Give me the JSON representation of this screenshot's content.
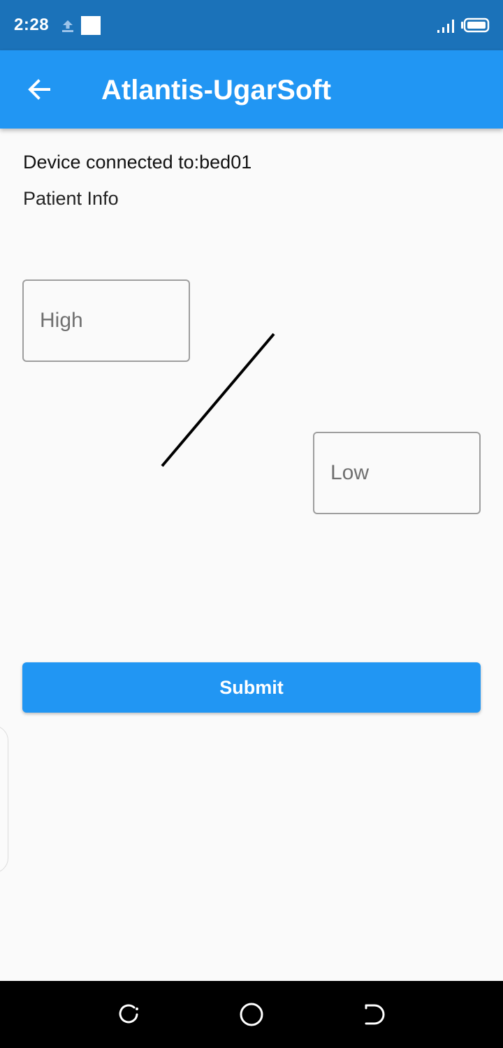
{
  "status_bar": {
    "time": "2:28",
    "icons": [
      "upload-icon",
      "notification-square",
      "signal-icon",
      "battery-icon"
    ]
  },
  "app_bar": {
    "title": "Atlantis-UgarSoft",
    "back_icon": "arrow-back-icon"
  },
  "content": {
    "device_connected": "Device connected to:bed01",
    "patient_info": "Patient Info",
    "high_placeholder": "High",
    "low_placeholder": "Low",
    "submit_label": "Submit"
  },
  "nav_bar": {
    "icons": [
      "recent-apps-icon",
      "home-icon",
      "back-icon"
    ]
  },
  "colors": {
    "status_bar": "#1b72b9",
    "primary": "#2196f3",
    "background": "#fafafa"
  }
}
